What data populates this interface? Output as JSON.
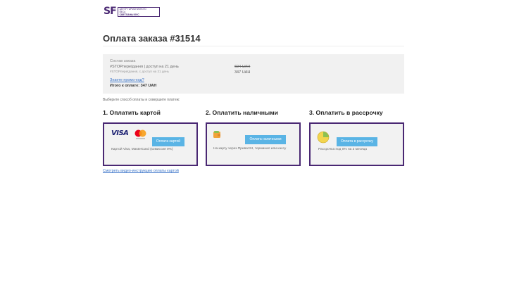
{
  "logo": {
    "mark": "SF",
    "line1": "ЦЕНТР ГАРМОНИЧНОГО",
    "line2": "ВЕСА",
    "line3": "СВЕТЛАНЫ ФУС"
  },
  "page": {
    "title": "Оплата заказа #31514",
    "choose_text": "Выберите способ оплаты и совершите платеж:",
    "video_link": "Смотреть видео-инструкцию оплаты картой"
  },
  "order": {
    "label": "Состав заказа",
    "item_title": "#STOPпереїдання | доступ на 21 день",
    "item_subtitle": "#STOPпереїдання, с доступ на 21 день",
    "price_old": "694 UAH",
    "price_new": "347 UAH",
    "promo_link": "Знаете промо-код?",
    "total": "Итого к оплате: 347 UAH"
  },
  "options": [
    {
      "title": "1. Оплатить картой",
      "button": "Оплата картой",
      "description": "Картой Visa, MasterCard (комиссия 0%)",
      "icon": "visa-mastercard-icon",
      "brand": "VISA"
    },
    {
      "title": "2. Оплатить наличными",
      "button": "Оплата наличными",
      "description": "На карту через Приват24, терминал или кассу",
      "icon": "wallet-icon"
    },
    {
      "title": "3. Оплатить в рассрочку",
      "button": "Оплата в рассрочку",
      "description": "Рассрочка под 0% на 2 месяца",
      "icon": "pie-chart-icon"
    }
  ],
  "colors": {
    "brand": "#4a2873",
    "button": "#5ab4e5",
    "link": "#3a74c9",
    "order_bg": "#f1f1f1"
  }
}
